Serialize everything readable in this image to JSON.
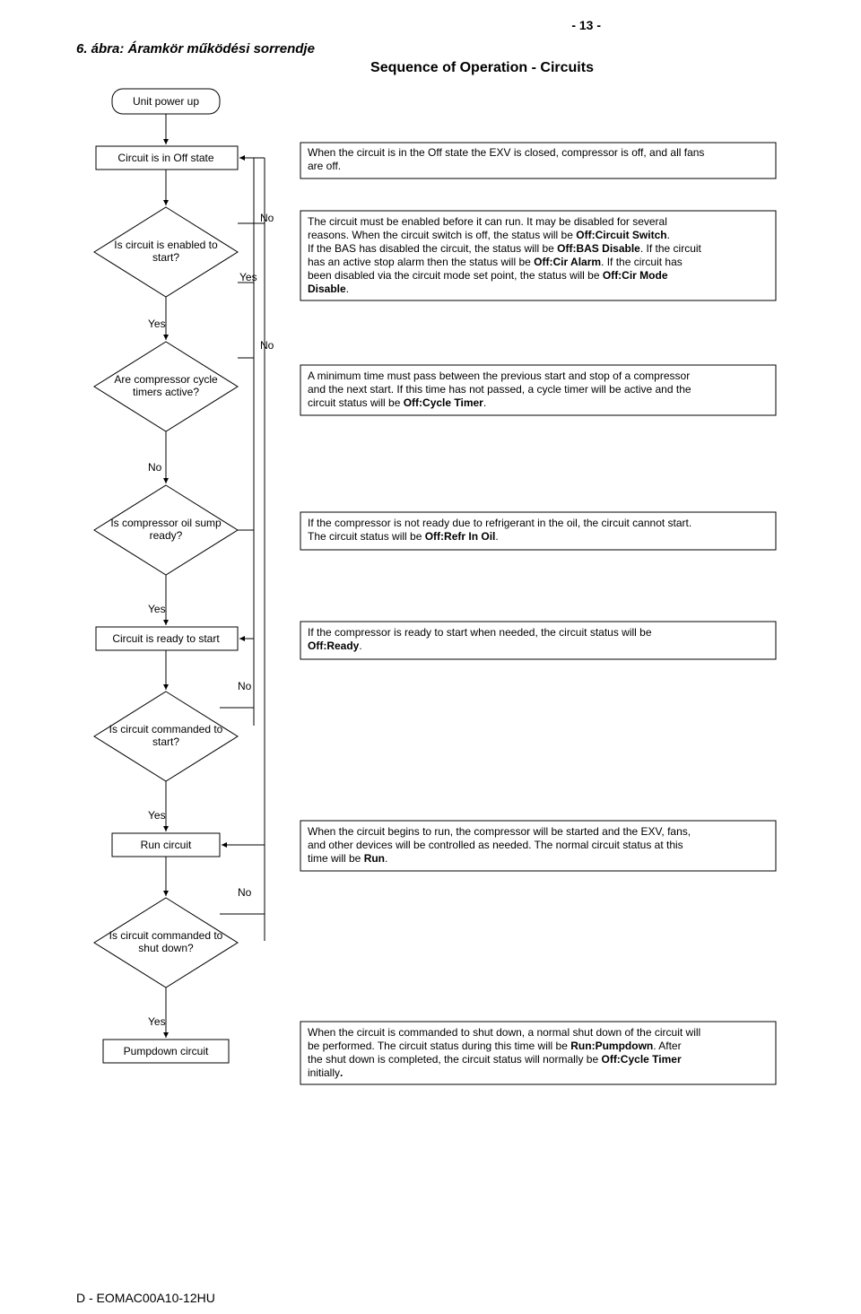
{
  "page_number_text": "- 13 -",
  "caption": "6. ábra: Áramkör működési sorrendje",
  "subtitle": "Sequence of Operation - Circuits",
  "footer": "D - EOMAC00A10-12HU",
  "labels": {
    "yes": "Yes",
    "no": "No",
    "unit_power_up": "Unit power up",
    "off_state": "Circuit is in Off state",
    "enabled_l1": "Is circuit is enabled to",
    "enabled_l2": "start?",
    "timers_l1": "Are compressor cycle",
    "timers_l2": "timers active?",
    "oil_l1": "Is compressor oil sump",
    "oil_l2": "ready?",
    "ready_start": "Circuit is ready to start",
    "cmd_start_l1": "Is circuit commanded to",
    "cmd_start_l2": "start?",
    "run_circuit": "Run circuit",
    "cmd_shut_l1": "Is circuit commanded to",
    "cmd_shut_l2": "shut down?",
    "pumpdown": "Pumpdown circuit"
  },
  "desc": {
    "off_full": "When the circuit is in the Off state the EXV is closed, compressor is off, and all fans are off.",
    "en_l1": "The circuit must be enabled before it can run.  It may be disabled for several",
    "en_l2a": "reasons.  When the circuit switch is off, the status will be ",
    "en_l2b": "Off:Circuit Switch",
    "en_l2c": ".",
    "en_l3a": "If the BAS has disabled the circuit, the status will be ",
    "en_l3b": "Off:BAS Disable",
    "en_l3c": ".  If the circuit",
    "en_l4a": "has an active stop alarm then the status will be ",
    "en_l4b": "Off:Cir Alarm",
    "en_l4c": ".  If the circuit has",
    "en_l5a": "been disabled via the circuit mode set point, the status will be ",
    "en_l5b": "Off:Cir Mode",
    "en_l6a": "Disable",
    "en_l6b": ".",
    "tm_l1": "A minimum time must pass between the previous start and stop of a compressor",
    "tm_l2": "and the next start.  If this time has not passed, a cycle timer will be active and the",
    "tm_l3a": "circuit status will be ",
    "tm_l3b": "Off:Cycle Timer",
    "tm_l3c": ".",
    "oil_l1": "If the compressor is not ready due to refrigerant in the oil, the circuit cannot start.",
    "oil_l2a": "The circuit status will be ",
    "oil_l2b": "Off:Refr In Oil",
    "oil_l2c": ".",
    "rdy_l1": "If the compressor is ready to start when needed, the circuit status will be",
    "rdy_l2a": "Off:Ready",
    "rdy_l2b": ".",
    "run_l1": "When the circuit begins to run, the compressor will be started and the EXV, fans,",
    "run_l2": "and other devices will be controlled as needed.  The normal circuit status at this",
    "run_l3a": "time will be ",
    "run_l3b": "Run",
    "run_l3c": ".",
    "pd_l1": "When the circuit is commanded to shut down, a normal shut down of the circuit will",
    "pd_l2a": "be performed.  The circuit status during this time will be ",
    "pd_l2b": "Run:Pumpdown",
    "pd_l2c": ".  After",
    "pd_l3a": "the shut down is completed, the circuit status will normally be ",
    "pd_l3b": "Off:Cycle Timer",
    "pd_l4a": "initially",
    "pd_l4b": "."
  }
}
